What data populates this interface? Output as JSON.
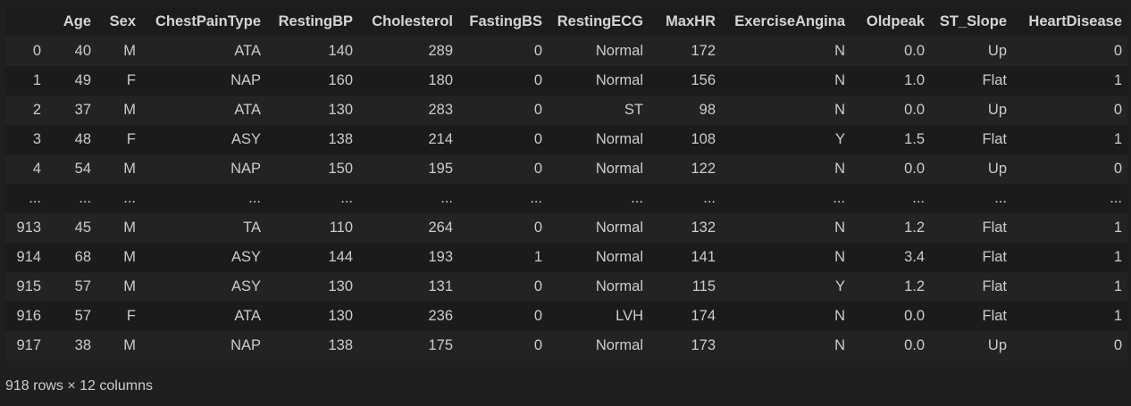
{
  "table": {
    "index_header": "",
    "columns": [
      "Age",
      "Sex",
      "ChestPainType",
      "RestingBP",
      "Cholesterol",
      "FastingBS",
      "RestingECG",
      "MaxHR",
      "ExerciseAngina",
      "Oldpeak",
      "ST_Slope",
      "HeartDisease"
    ],
    "rows": [
      {
        "index": "0",
        "cells": [
          "40",
          "M",
          "ATA",
          "140",
          "289",
          "0",
          "Normal",
          "172",
          "N",
          "0.0",
          "Up",
          "0"
        ]
      },
      {
        "index": "1",
        "cells": [
          "49",
          "F",
          "NAP",
          "160",
          "180",
          "0",
          "Normal",
          "156",
          "N",
          "1.0",
          "Flat",
          "1"
        ]
      },
      {
        "index": "2",
        "cells": [
          "37",
          "M",
          "ATA",
          "130",
          "283",
          "0",
          "ST",
          "98",
          "N",
          "0.0",
          "Up",
          "0"
        ]
      },
      {
        "index": "3",
        "cells": [
          "48",
          "F",
          "ASY",
          "138",
          "214",
          "0",
          "Normal",
          "108",
          "Y",
          "1.5",
          "Flat",
          "1"
        ]
      },
      {
        "index": "4",
        "cells": [
          "54",
          "M",
          "NAP",
          "150",
          "195",
          "0",
          "Normal",
          "122",
          "N",
          "0.0",
          "Up",
          "0"
        ]
      },
      {
        "index": "...",
        "cells": [
          "...",
          "...",
          "...",
          "...",
          "...",
          "...",
          "...",
          "...",
          "...",
          "...",
          "...",
          "..."
        ]
      },
      {
        "index": "913",
        "cells": [
          "45",
          "M",
          "TA",
          "110",
          "264",
          "0",
          "Normal",
          "132",
          "N",
          "1.2",
          "Flat",
          "1"
        ]
      },
      {
        "index": "914",
        "cells": [
          "68",
          "M",
          "ASY",
          "144",
          "193",
          "1",
          "Normal",
          "141",
          "N",
          "3.4",
          "Flat",
          "1"
        ]
      },
      {
        "index": "915",
        "cells": [
          "57",
          "M",
          "ASY",
          "130",
          "131",
          "0",
          "Normal",
          "115",
          "Y",
          "1.2",
          "Flat",
          "1"
        ]
      },
      {
        "index": "916",
        "cells": [
          "57",
          "F",
          "ATA",
          "130",
          "236",
          "0",
          "LVH",
          "174",
          "N",
          "0.0",
          "Flat",
          "1"
        ]
      },
      {
        "index": "917",
        "cells": [
          "38",
          "M",
          "NAP",
          "138",
          "175",
          "0",
          "Normal",
          "173",
          "N",
          "0.0",
          "Up",
          "0"
        ]
      }
    ]
  },
  "footer": {
    "shape_text": "918 rows × 12 columns"
  }
}
